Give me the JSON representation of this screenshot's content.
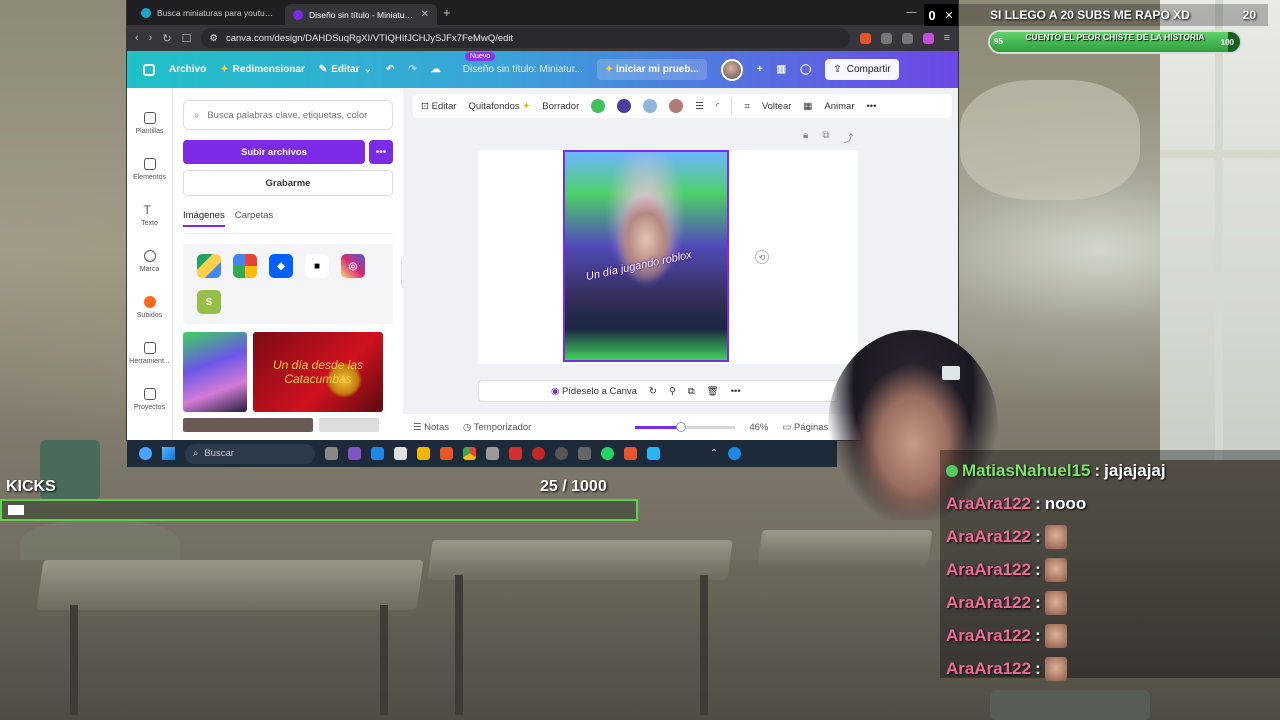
{
  "browser": {
    "tabs": [
      {
        "label": "Busca miniaturas para youtube - Canva",
        "active": false
      },
      {
        "label": "Diseño sin título - Miniatura para Y",
        "active": true
      }
    ],
    "url": "canva.com/design/DAHDSuqRgXI/VTIQHIfJCHJySJFx7FeMwQ/edit"
  },
  "canva_header": {
    "archivo": "Archivo",
    "redimensionar": "Redimensionar",
    "editar": "Editar",
    "nuevo_badge": "Nuevo",
    "doc_title": "Diseño sin título: Miniatur...",
    "trial": "iniciar mi prueb...",
    "share": "Compartir"
  },
  "rail": [
    {
      "label": "Plantillas",
      "icon": "layout-icon"
    },
    {
      "label": "Elementos",
      "icon": "shapes-icon"
    },
    {
      "label": "Texto",
      "icon": "text-icon"
    },
    {
      "label": "Marca",
      "icon": "brand-icon"
    },
    {
      "label": "Subidos",
      "icon": "cloud-upload-icon"
    },
    {
      "label": "Herramient...",
      "icon": "tools-icon"
    },
    {
      "label": "Proyectos",
      "icon": "folder-icon"
    }
  ],
  "panel": {
    "search_placeholder": "Busca palabras clave, etiquetas, color",
    "upload_btn": "Subir archivos",
    "record_btn": "Grabarme",
    "tab_images": "Imágenes",
    "tab_folders": "Carpetas",
    "thumb2_text": "Un día desde las Catacumbas"
  },
  "edit_toolbar": {
    "editar": "Editar",
    "quitafondos": "Quitafondos",
    "borrador": "Borrador",
    "voltear": "Voltear",
    "animar": "Animar",
    "swatches": [
      "#3fc45b",
      "#4b3ea0",
      "#8fb6d8",
      "#b07a78"
    ]
  },
  "design": {
    "overlay_text": "Un día jugando roblox"
  },
  "float_bar": {
    "label": "Pídeselo a Canva"
  },
  "bottom_bar": {
    "notas": "Notas",
    "temporizador": "Temporizador",
    "zoom": "46%",
    "zoom_value": 0.46,
    "paginas": "Páginas"
  },
  "taskbar": {
    "search": "Buscar"
  },
  "overlays": {
    "top_counter": "0",
    "goal_title": "SI LLEGO A 20 SUBS ME RAPO XD",
    "goal_target": "20",
    "goal_bar_label": "CUENTO EL PEOR CHISTE DE LA HISTORIA",
    "goal_bar_current": "95",
    "goal_bar_max": "100",
    "goal_bar_progress": 0.95,
    "kicks_title": "KICKS",
    "kicks_count": "25  / 1000",
    "kicks_progress": 0.025
  },
  "chat": [
    {
      "user": "MatiasNahuel15",
      "msg": "jajajajaj",
      "verified": true,
      "emote": false
    },
    {
      "user": "AraAra122",
      "msg": "nooo",
      "verified": false,
      "emote": false
    },
    {
      "user": "AraAra122",
      "msg": "",
      "verified": false,
      "emote": true
    },
    {
      "user": "AraAra122",
      "msg": "",
      "verified": false,
      "emote": true
    },
    {
      "user": "AraAra122",
      "msg": "",
      "verified": false,
      "emote": true
    },
    {
      "user": "AraAra122",
      "msg": "",
      "verified": false,
      "emote": true
    },
    {
      "user": "AraAra122",
      "msg": "",
      "verified": false,
      "emote": true
    }
  ]
}
